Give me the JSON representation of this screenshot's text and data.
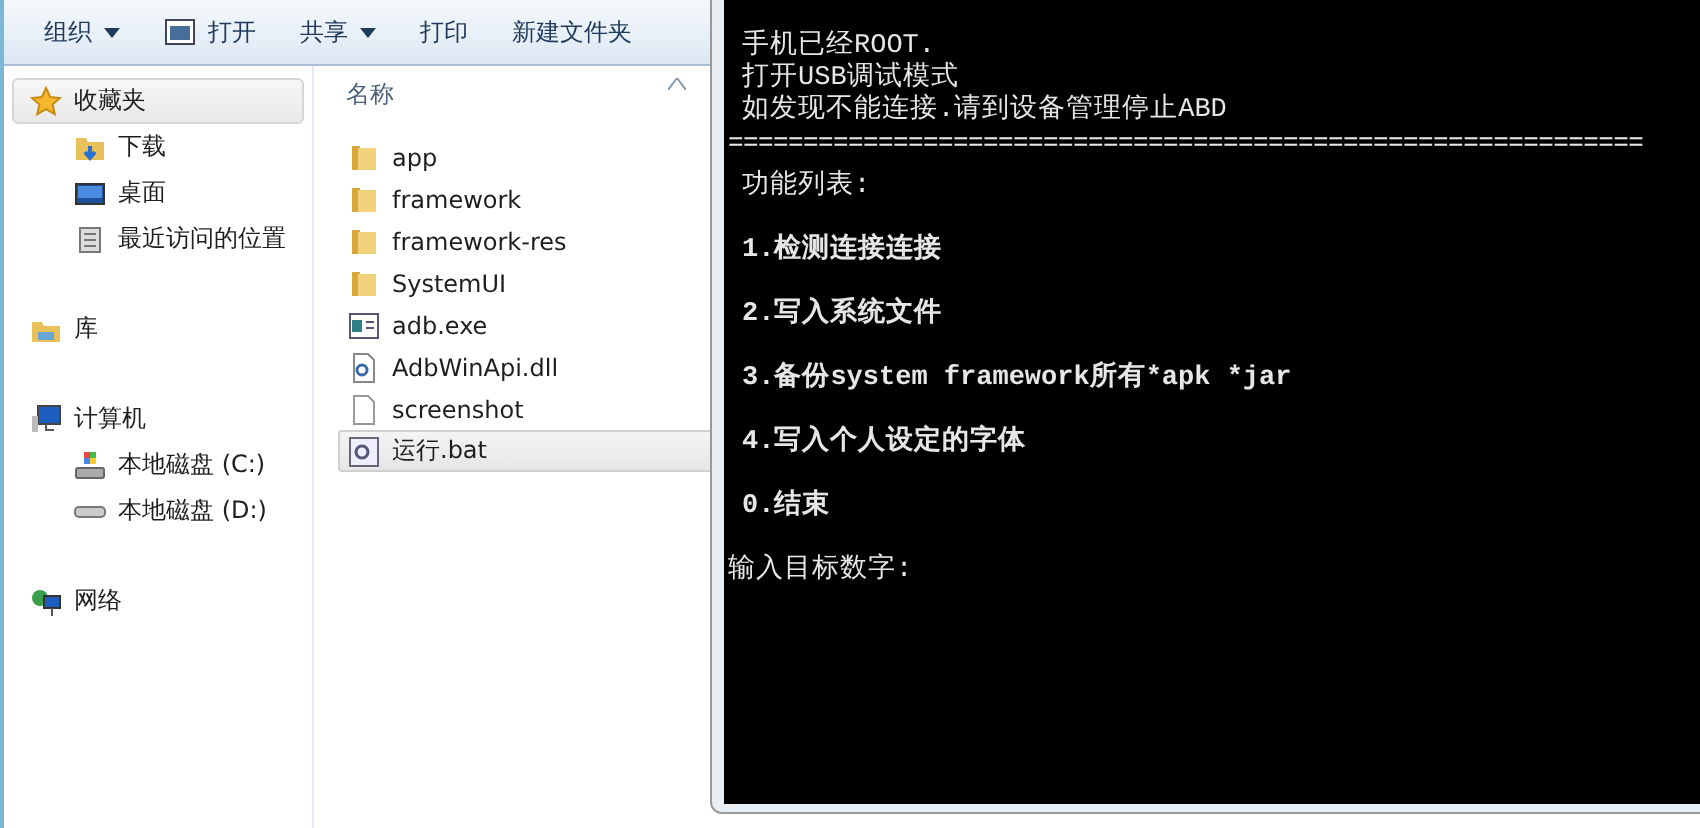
{
  "explorer": {
    "toolbar": [
      {
        "label": "组织",
        "kind": "dropdown"
      },
      {
        "label": "打开",
        "kind": "icon"
      },
      {
        "label": "共享",
        "kind": "dropdown"
      },
      {
        "label": "打印",
        "kind": "plain"
      },
      {
        "label": "新建文件夹",
        "kind": "plain"
      }
    ],
    "sidebar": [
      {
        "label": "收藏夹",
        "kind": "star",
        "selected": true,
        "children": [
          {
            "label": "下载",
            "kind": "download",
            "selected": false
          },
          {
            "label": "桌面",
            "kind": "desktop",
            "selected": false
          },
          {
            "label": "最近访问的位置",
            "kind": "recent",
            "selected": false
          }
        ]
      },
      {
        "label": "库",
        "kind": "library",
        "selected": false
      },
      {
        "label": "计算机",
        "kind": "computer",
        "selected": false,
        "children": [
          {
            "label": "本地磁盘 (C:)",
            "kind": "system-drive",
            "selected": false
          },
          {
            "label": "本地磁盘 (D:)",
            "kind": "drive",
            "selected": false
          }
        ]
      },
      {
        "label": "网络",
        "kind": "network",
        "selected": false
      }
    ],
    "column_header": "名称",
    "files": [
      {
        "name": "app",
        "kind": "folder",
        "selected": false
      },
      {
        "name": "framework",
        "kind": "folder",
        "selected": false
      },
      {
        "name": "framework-res",
        "kind": "folder",
        "selected": false
      },
      {
        "name": "SystemUI",
        "kind": "folder",
        "selected": false
      },
      {
        "name": "adb.exe",
        "kind": "exe",
        "selected": false
      },
      {
        "name": "AdbWinApi.dll",
        "kind": "dll",
        "selected": false
      },
      {
        "name": "screenshot",
        "kind": "file",
        "selected": false
      },
      {
        "name": "运行.bat",
        "kind": "bat",
        "selected": true
      }
    ]
  },
  "console": {
    "header_lines": [
      "手机已经ROOT.",
      "打开USB调试模式",
      "如发现不能连接.请到设备管理停止ABD"
    ],
    "separator": "=============================================================",
    "menu_title": "功能列表:",
    "options": [
      "1.检测连接连接",
      "2.写入系统文件",
      "3.备份system framework所有*apk *jar",
      "4.写入个人设定的字体",
      "0.结束"
    ],
    "prompt": "输入目标数字:"
  }
}
